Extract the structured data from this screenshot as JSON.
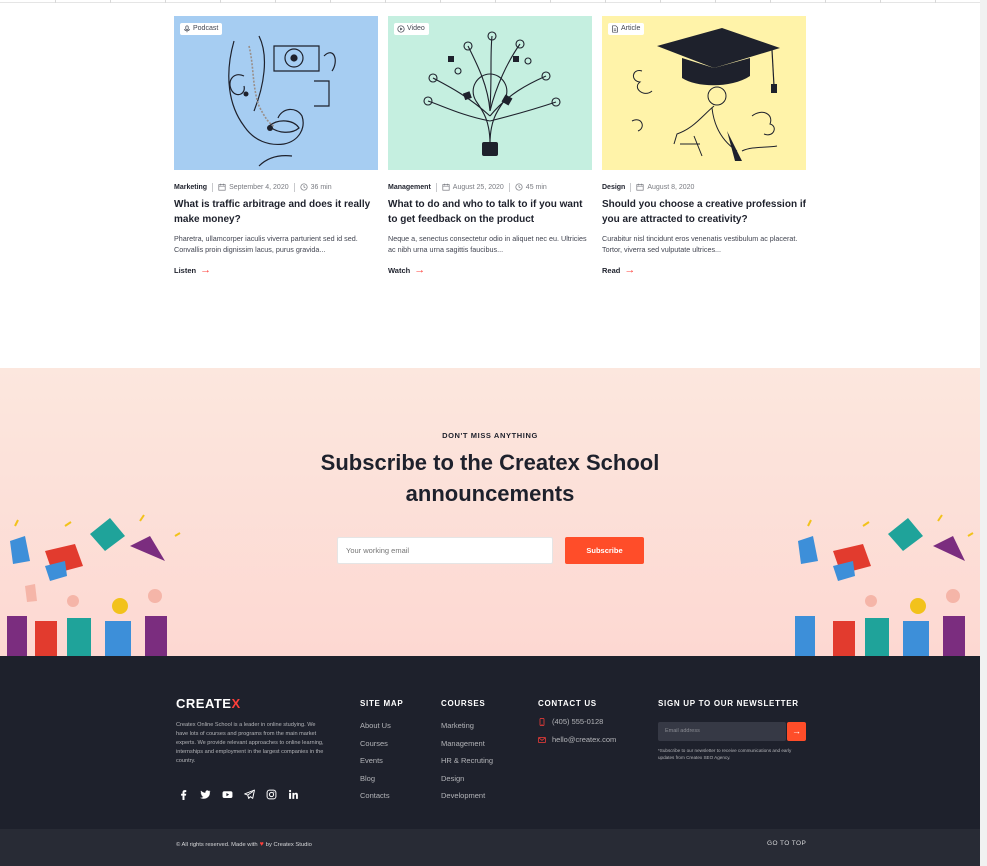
{
  "cards": [
    {
      "badge": "Podcast",
      "badge_icon": "microphone-icon",
      "bg": "#a6cdf2",
      "category": "Marketing",
      "date": "September 4, 2020",
      "duration": "36 min",
      "title": "What is traffic arbitrage and does it really make money?",
      "excerpt": "Pharetra, ullamcorper iaculis viverra parturient sed id sed. Convallis proin dignissim lacus, purus gravida...",
      "cta": "Listen"
    },
    {
      "badge": "Video",
      "badge_icon": "play-icon",
      "bg": "#c5efe0",
      "category": "Management",
      "date": "August 25, 2020",
      "duration": "45 min",
      "title": "What to do and who to talk to if you want to get feedback on the product",
      "excerpt": "Neque a, senectus consectetur odio in aliquet nec eu. Ultricies ac nibh urna urna sagittis faucibus...",
      "cta": "Watch"
    },
    {
      "badge": "Article",
      "badge_icon": "file-icon",
      "bg": "#fff3a9",
      "category": "Design",
      "date": "August 8, 2020",
      "duration": "",
      "title": "Should you choose a creative profession if you are attracted to creativity?",
      "excerpt": "Curabitur nisl tincidunt eros venenatis vestibulum ac placerat. Tortor, viverra sed vulputate ultrices...",
      "cta": "Read"
    }
  ],
  "subscribe": {
    "eyebrow": "DON'T MISS ANYTHING",
    "title": "Subscribe to the Createx School announcements",
    "placeholder": "Your working email",
    "button": "Subscribe"
  },
  "footer": {
    "logo_main": "CREATE",
    "logo_x": "X",
    "about": "Createx Online School is a leader in online studying. We have lots of courses and programs from the main market experts. We provide relevant approaches to online learning, internships and employment in the largest companies in the country.",
    "socials": [
      "facebook-icon",
      "twitter-icon",
      "youtube-icon",
      "telegram-icon",
      "instagram-icon",
      "linkedin-icon"
    ],
    "sitemap_title": "SITE MAP",
    "sitemap": [
      "About Us",
      "Courses",
      "Events",
      "Blog",
      "Contacts"
    ],
    "courses_title": "COURSES",
    "courses": [
      "Marketing",
      "Management",
      "HR & Recruting",
      "Design",
      "Development"
    ],
    "contact_title": "CONTACT US",
    "phone": "(405) 555-0128",
    "email": "hello@createx.com",
    "newsletter_title": "SIGN UP TO OUR NEWSLETTER",
    "newsletter_placeholder": "Email address",
    "newsletter_note": "*Subscribe to our newsletter to receive communications and early updates from Createx SEO Agency.",
    "copyright_pre": "© All rights reserved. Made with",
    "copyright_post": "by Createx Studio",
    "go_top": "GO TO TOP"
  },
  "colors": {
    "accent": "#ff3f3a",
    "dark": "#1e212c"
  }
}
